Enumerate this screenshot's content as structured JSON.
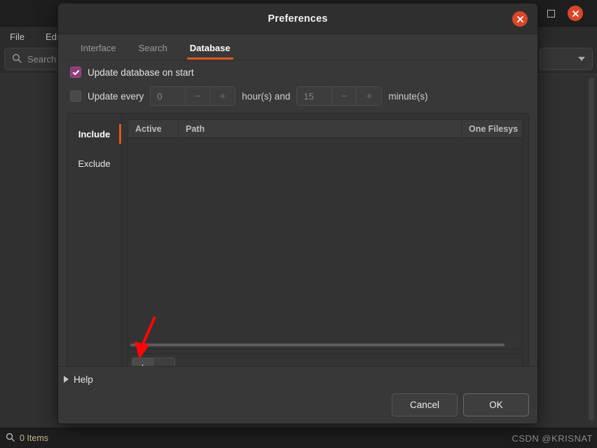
{
  "background_window": {
    "menu": [
      "File",
      "Edit"
    ],
    "search_placeholder": "Search",
    "search_icon": "search-icon",
    "maximize_icon": "maximize-icon",
    "close_icon": "close-icon",
    "dropdown_icon": "chevron-down-icon",
    "status": {
      "icon": "search-icon",
      "text": "0 Items"
    }
  },
  "dialog": {
    "title": "Preferences",
    "close_icon": "close-icon",
    "tabs": [
      {
        "label": "Interface",
        "active": false
      },
      {
        "label": "Search",
        "active": false
      },
      {
        "label": "Database",
        "active": true
      }
    ],
    "options": {
      "update_on_start": {
        "label": "Update database on start",
        "checked": true
      },
      "update_every": {
        "label": "Update every",
        "checked": false,
        "hours_value": "0",
        "hours_unit": "hour(s) and",
        "minutes_value": "15",
        "minutes_unit": "minute(s)",
        "decrement_icon": "minus-icon",
        "increment_icon": "plus-icon"
      }
    },
    "side_list": [
      {
        "label": "Include",
        "active": true
      },
      {
        "label": "Exclude",
        "active": false
      }
    ],
    "table": {
      "columns": [
        "Active",
        "Path",
        "One Filesys"
      ],
      "rows": []
    },
    "list_toolbar": {
      "add_label": "+",
      "add_icon": "plus-icon",
      "remove_label": "−",
      "remove_icon": "minus-icon"
    },
    "footer": {
      "help_label": "Help",
      "help_expander_icon": "triangle-right-icon",
      "cancel_label": "Cancel",
      "ok_label": "OK"
    }
  },
  "annotation": {
    "arrow_color": "#fb0606",
    "arrow_target": "add-button"
  },
  "watermark": "CSDN @KRISNAT",
  "colors": {
    "accent_orange": "#e25822",
    "checkbox_purple": "#8e3d7c",
    "close_red": "#d9472a",
    "status_text": "#c9b28a"
  }
}
